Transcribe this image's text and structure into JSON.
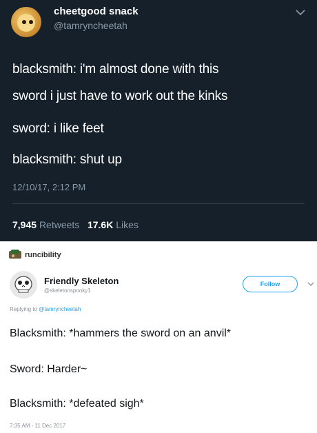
{
  "tweet1": {
    "display_name": "cheetgood snack",
    "handle": "@tamryncheetah",
    "lines": [
      "blacksmith: i'm almost done with this",
      "sword i just have to work out the kinks",
      "sword: i like feet",
      "blacksmith: shut up"
    ],
    "timestamp": "12/10/17, 2:12 PM",
    "retweets_count": "7,945",
    "retweets_label": "Retweets",
    "likes_count": "17.6K",
    "likes_label": "Likes"
  },
  "tweet2": {
    "retweeted_by": "runcibility",
    "display_name": "Friendly Skeleton",
    "handle": "@skeletonspooky1",
    "follow_label": "Follow",
    "replying_prefix": "Replying to",
    "replying_to": "@tamryncheetah",
    "lines": [
      "Blacksmith: *hammers the sword on an anvil*",
      "Sword: Harder~",
      "Blacksmith: *defeated sigh*"
    ],
    "timestamp": "7:35 AM - 11 Dec 2017"
  },
  "colors": {
    "dark_bg": "#15202b",
    "muted": "#8899a6",
    "accent": "#1da1f2"
  }
}
